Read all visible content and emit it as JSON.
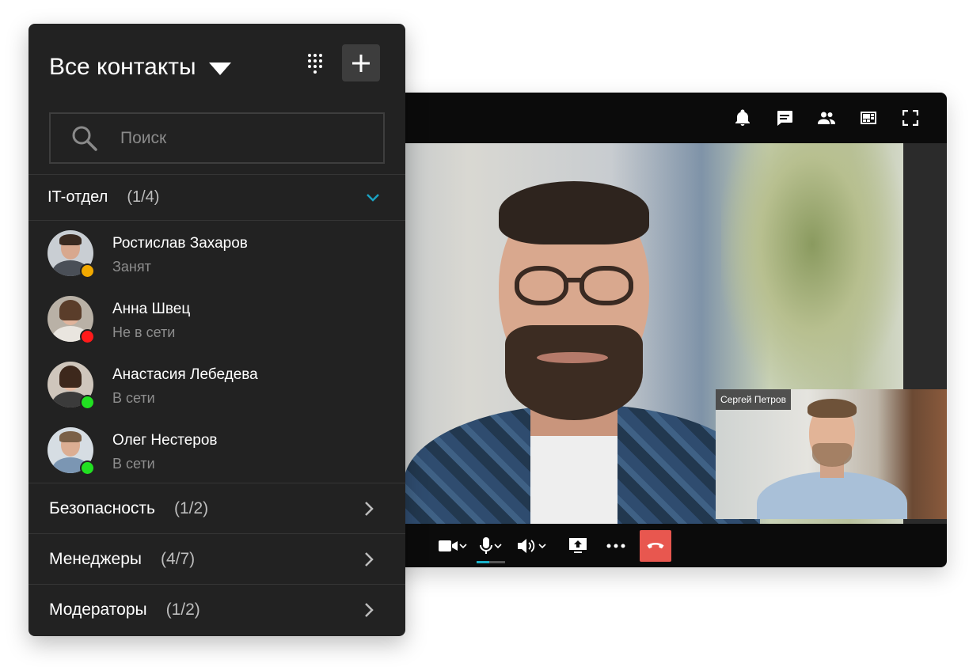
{
  "contacts_panel": {
    "title": "Все контакты",
    "search_placeholder": "Поиск",
    "groups": [
      {
        "name": "IT-отдел",
        "count": "(1/4)",
        "expanded": true,
        "members": [
          {
            "name": "Ростислав Захаров",
            "status": "Занят",
            "status_color": "#f2a900"
          },
          {
            "name": "Анна Швец",
            "status": "Не в сети",
            "status_color": "#ff1a1a"
          },
          {
            "name": "Анастасия Лебедева",
            "status": "В сети",
            "status_color": "#21e021"
          },
          {
            "name": "Олег Нестеров",
            "status": "В сети",
            "status_color": "#21e021"
          }
        ]
      },
      {
        "name": "Безопасность",
        "count": "(1/2)",
        "expanded": false
      },
      {
        "name": "Менеджеры",
        "count": "(4/7)",
        "expanded": false
      },
      {
        "name": "Модераторы",
        "count": "(1/2)",
        "expanded": false
      }
    ]
  },
  "call_window": {
    "pip_participant": "Сергей Петров",
    "top_icons": [
      "bell-icon",
      "chat-icon",
      "participants-icon",
      "layout-icon",
      "fullscreen-icon"
    ],
    "mic_level": 0.45,
    "colors": {
      "hangup": "#e8574f",
      "mic_level": "#18b0c8",
      "chevron_accent": "#1aa3c2"
    }
  }
}
